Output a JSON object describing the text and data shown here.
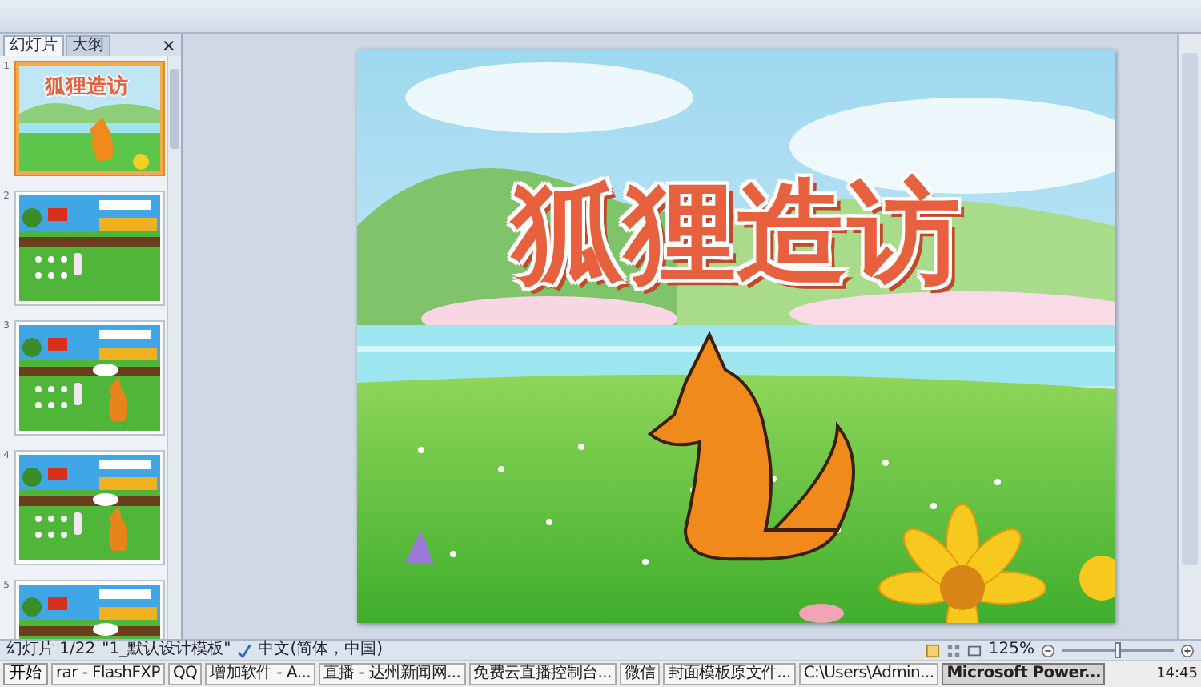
{
  "panel": {
    "tabs": [
      {
        "label": "幻灯片",
        "selected": true
      },
      {
        "label": "大纲",
        "selected": false
      }
    ],
    "close": "×",
    "thumbnails": [
      {
        "number": "1",
        "kind": "title",
        "title": "狐狸造访",
        "selected": true
      },
      {
        "number": "2",
        "kind": "farm",
        "selected": false
      },
      {
        "number": "3",
        "kind": "farm_fox",
        "selected": false
      },
      {
        "number": "4",
        "kind": "farm_fox",
        "selected": false
      },
      {
        "number": "5",
        "kind": "farm_fox",
        "selected": false
      }
    ]
  },
  "slide": {
    "title": "狐狸造访"
  },
  "status_bar": {
    "slide_counter": "幻灯片 1/22",
    "theme": "\"1_默认设计模板\"",
    "language": "中文(简体，中国)",
    "zoom": "125%",
    "zoom_slider": {
      "level": 0.5
    }
  },
  "taskbar": {
    "start": "开始",
    "items": [
      {
        "label": "rar - FlashFXP",
        "selected": false
      },
      {
        "label": "QQ",
        "selected": false
      },
      {
        "label": "增加软件 - A...",
        "selected": false
      },
      {
        "label": "直播 - 达州新闻网...",
        "selected": false
      },
      {
        "label": "免费云直播控制台...",
        "selected": false
      },
      {
        "label": "微信",
        "selected": false
      },
      {
        "label": "封面模板原文件...",
        "selected": false
      },
      {
        "label": "C:\\Users\\Admin...",
        "selected": false
      },
      {
        "label": "Microsoft Power...",
        "selected": true
      }
    ],
    "clock": "14:45"
  }
}
